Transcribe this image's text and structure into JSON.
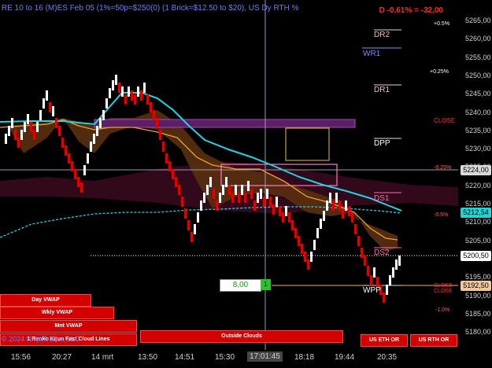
{
  "window": {
    "title": "RE 10 to 16 (M)ES Feb 05 (1%=50p=$250(0) (1 Brick=$12.50 to $20), US Dy RTH %",
    "pnl": "D -0,61% = -32,00"
  },
  "pivots": [
    {
      "label": "DR2",
      "color": "#e8c9a8"
    },
    {
      "label": "WR1",
      "color": "#7f87f5"
    },
    {
      "label": "DR1",
      "color": "#e8c9a8"
    },
    {
      "label": "DPP",
      "color": "#ffffff"
    },
    {
      "label": "DS1",
      "color": "#ff6ab0"
    },
    {
      "label": "DS2",
      "color": "#ff6ab0"
    },
    {
      "label": "WPP",
      "color": "#ffffff"
    }
  ],
  "pct_labels": [
    {
      "text": "+0.5%",
      "color": "#ffffff"
    },
    {
      "text": "+0.25%",
      "color": "#ffffff"
    },
    {
      "text": "CLOSE",
      "color": "#ff2a2a"
    },
    {
      "text": "-0.25%",
      "color": "#ff6060"
    },
    {
      "text": "-0.5%",
      "color": "#ff6060"
    },
    {
      "text": "CLOSE",
      "color": "#ff2a2a"
    },
    {
      "text": "CLOSE",
      "color": "#ff2a2a"
    },
    {
      "text": "-1.0%",
      "color": "#ff6060"
    }
  ],
  "price_axis": [
    "5265,00",
    "5260,00",
    "5255,00",
    "5250,00",
    "5245,00",
    "5240,00",
    "5235,00",
    "5230,00",
    "5225,00",
    "5220,00",
    "5215,00",
    "5210,00",
    "5205,00",
    "5200,00",
    "5195,00",
    "5190,00",
    "5185,00",
    "5180,00"
  ],
  "price_tags": [
    {
      "text": "5224,00",
      "bg": "#d9d9d9",
      "fg": "#000000"
    },
    {
      "text": "5212,54",
      "bg": "#1ed6d6",
      "fg": "#000000"
    },
    {
      "text": "5200,50",
      "bg": "#ffffff",
      "fg": "#000000"
    },
    {
      "text": "5192,50",
      "bg": "#f1c79a",
      "fg": "#000000"
    }
  ],
  "time_axis": [
    "15:56",
    "20:27",
    "14 mrt",
    "13:50",
    "14:51",
    "15:30",
    "17:01:45",
    "18:18",
    "19:44",
    "20:35"
  ],
  "order_qty": "8,00",
  "order_btn": "1",
  "vwap_buttons": [
    "Day VWAP",
    "Wkly VWAP",
    "Mnt VWAP",
    "1 Renko Kijun Fast Cloud Lines",
    "Outside Clouds",
    "US ETH OR",
    "US RTH OR"
  ],
  "copyright": "© 2024 NinjaTrader, LLC",
  "colors": {
    "up_brick": "#ffffff",
    "down_brick": "#e00000",
    "cyan": "#22d3e0",
    "orange": "#f0a030",
    "purple": "#a040c0"
  }
}
